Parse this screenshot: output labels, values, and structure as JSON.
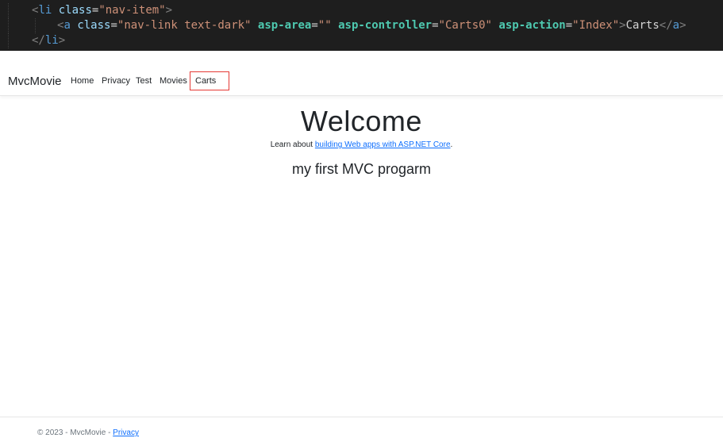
{
  "code": {
    "line1": {
      "open_bracket": "<",
      "tag": "li",
      "attr": "class",
      "eq": "=",
      "value": "\"nav-item\"",
      "close_bracket": ">"
    },
    "line2": {
      "open_bracket": "<",
      "tag": "a",
      "attr_class": "class",
      "value_class": "\"nav-link text-dark\"",
      "attr_area": "asp-area",
      "value_area": "\"\"",
      "attr_controller": "asp-controller",
      "value_controller": "\"Carts0\"",
      "attr_action": "asp-action",
      "value_action": "\"Index\"",
      "text": "Carts",
      "close_tag": "</",
      "close_tag_name": "a",
      "close_end": ">"
    },
    "line3": {
      "open": "</",
      "tag": "li",
      "close": ">"
    }
  },
  "navbar": {
    "brand": "MvcMovie",
    "links": [
      "Home",
      "Privacy",
      "Test",
      "Movies",
      "Carts"
    ]
  },
  "main": {
    "title": "Welcome",
    "learn_prefix": "Learn about ",
    "learn_link": "building Web apps with ASP.NET Core",
    "learn_suffix": ".",
    "subtitle": "my first MVC progarm"
  },
  "footer": {
    "prefix": "© 2023 - MvcMovie - ",
    "link": "Privacy"
  },
  "colors": {
    "code_bg": "#1e1e1e",
    "highlight": "#e53935",
    "link": "#0d6efd"
  }
}
